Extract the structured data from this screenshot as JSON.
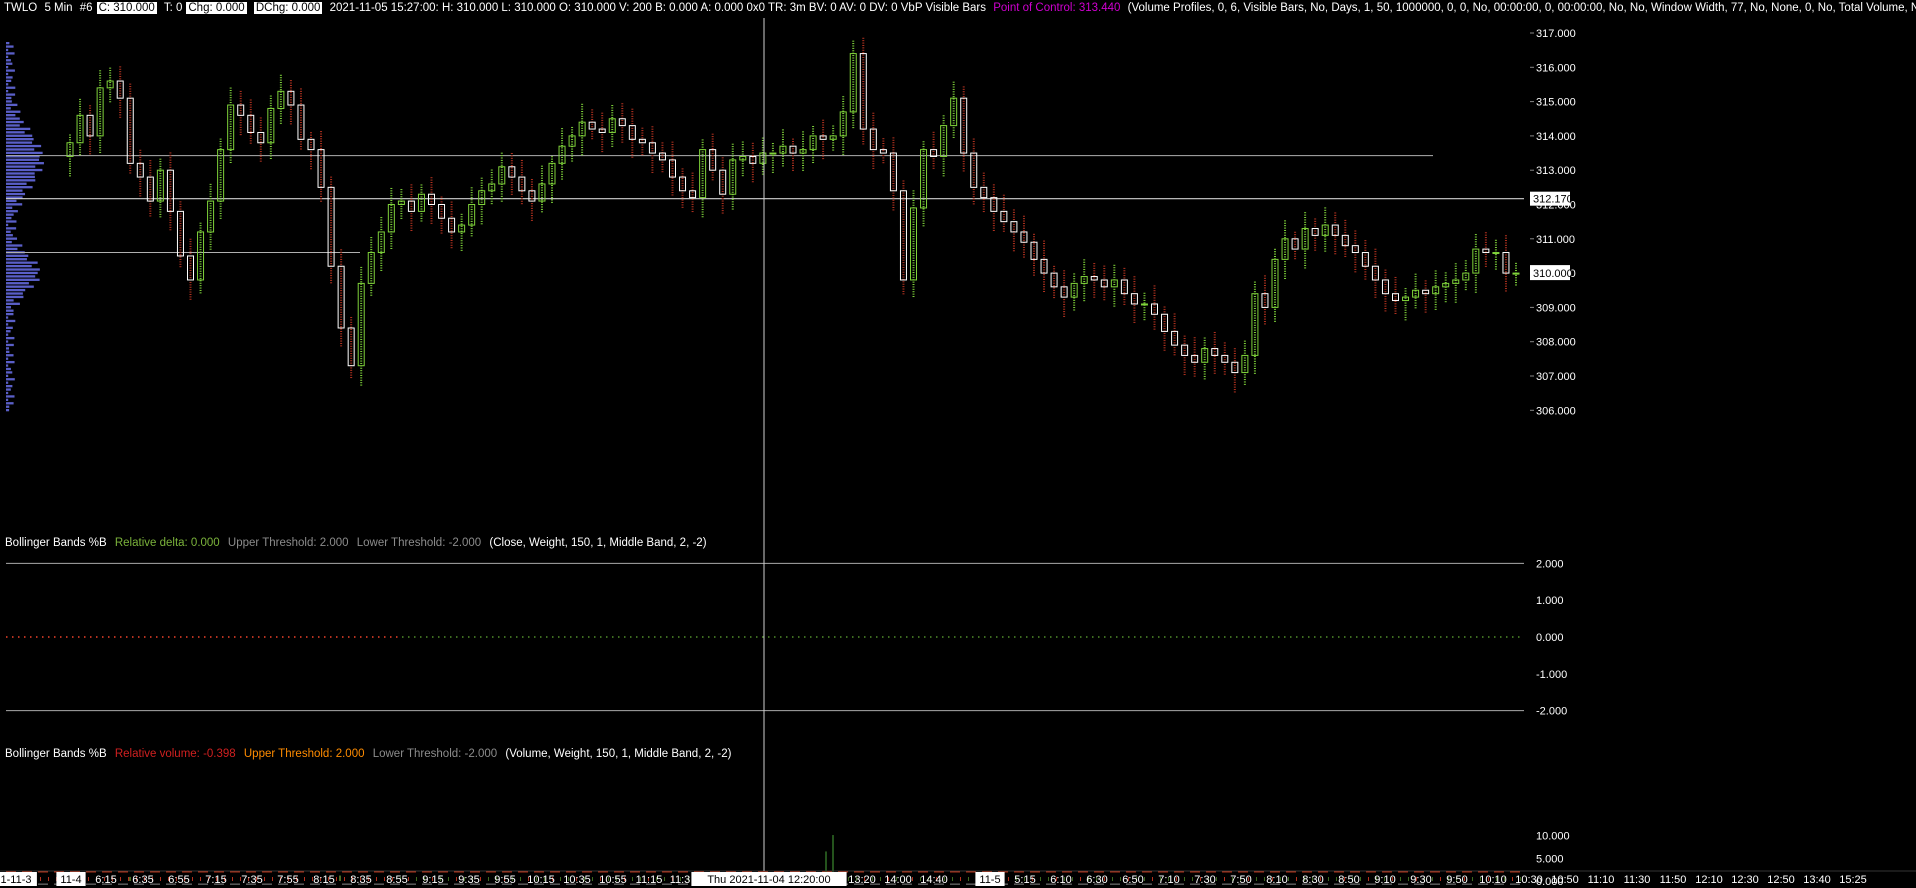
{
  "header": {
    "symbol": "TWLO",
    "interval": "5 Min",
    "chart_no": "#6",
    "close_box": "C: 310.000",
    "t_field": "T: 0",
    "chg_box": "Chg: 0.000",
    "dchg_box": "DChg: 0.000",
    "ohlc_text": "2021-11-05 15:27:00: H: 310.000 L: 310.000 O: 310.000 V: 200 B: 0.000 A: 0.000 0x0 TR: 3m BV: 0 AV: 0 DV: 0 VbP Visible Bars",
    "poc_text": "Point of Control: 313.440",
    "study_params": "(Volume Profiles, 0, 6, Visible Bars, No, Days, 1, 50, 1000000, 0, 0, No, 00:00:00, 0, 00:00:00, No, No, Window Width, 77, No, None, 0, No, Total Volume, No"
  },
  "panel2": {
    "title": "Bollinger Bands %B",
    "rel_label": "Relative delta: 0.000",
    "upper": "Upper Threshold: 2.000",
    "lower": "Lower Threshold: -2.000",
    "params": "(Close, Weight, 150, 1, Middle Band, 2, -2)"
  },
  "panel3": {
    "title": "Bollinger Bands %B",
    "rel_label": "Relative volume: -0.398",
    "upper": "Upper Threshold: 2.000",
    "lower": "Lower Threshold: -2.000",
    "params": "(Volume, Weight, 150, 1, Middle Band, 2, -2)"
  },
  "colors": {
    "bg": "#000000",
    "up": "#7fd33a",
    "down": "#b43220",
    "profile": "#5a5fc8",
    "line": "#b0b0b0",
    "text": "#ffffff"
  },
  "chart_data": [
    {
      "type": "candlestick",
      "title": "TWLO 5 Min",
      "ylim": [
        305.6,
        317.3
      ],
      "yticks": [
        "317.000",
        "316.000",
        "315.000",
        "314.000",
        "313.000",
        "312.000",
        "311.000",
        "310.000",
        "309.000",
        "308.000",
        "307.000",
        "306.000"
      ],
      "ytick_values": [
        317,
        316,
        315,
        314,
        313,
        312,
        311,
        310,
        309,
        308,
        307,
        306
      ],
      "current_price_tag": "312.170",
      "current_price": 312.17,
      "last_price_tag": "310.000",
      "last_price": 310.0,
      "point_of_control": 313.44,
      "value_area_low": 310.6,
      "xlabels": [
        "1-11-3",
        "11-4",
        "6:15",
        "6:35",
        "6:55",
        "7:15",
        "7:35",
        "7:55",
        "8:15",
        "8:35",
        "8:55",
        "9:15",
        "9:35",
        "9:55",
        "10:15",
        "10:35",
        "10:55",
        "11:15",
        "11:3",
        "Thu 2021-11-04  12:20:00",
        "5",
        "13:20",
        "14:00",
        "14:40",
        "11-5",
        "5:15",
        "6:10",
        "6:30",
        "6:50",
        "7:10",
        "7:30",
        "7:50",
        "8:10",
        "8:30",
        "8:50",
        "9:10",
        "9:30",
        "9:50",
        "10:10",
        "10:30",
        "10:50",
        "11:10",
        "11:30",
        "11:50",
        "12:10",
        "12:30",
        "12:50",
        "13:40",
        "15:25"
      ],
      "closes": [
        313.8,
        314.6,
        314.0,
        315.4,
        315.6,
        315.1,
        313.2,
        312.8,
        312.1,
        313.0,
        311.8,
        310.5,
        309.8,
        311.2,
        312.1,
        313.6,
        314.9,
        314.6,
        314.1,
        313.8,
        314.8,
        315.3,
        314.9,
        313.9,
        313.6,
        312.5,
        310.2,
        308.4,
        307.3,
        309.7,
        310.6,
        311.2,
        312.0,
        312.1,
        311.8,
        312.3,
        312.0,
        311.6,
        311.2,
        311.4,
        312.0,
        312.4,
        312.6,
        313.1,
        312.8,
        312.4,
        312.1,
        312.6,
        313.2,
        313.7,
        314.0,
        314.4,
        314.2,
        314.1,
        314.5,
        314.3,
        313.9,
        313.8,
        313.5,
        313.3,
        312.8,
        312.4,
        312.2,
        313.6,
        313.0,
        312.3,
        313.3,
        313.4,
        313.2,
        313.5,
        313.5,
        313.7,
        313.5,
        313.6,
        314.0,
        313.9,
        314.0,
        314.7,
        316.4,
        314.2,
        313.6,
        313.5,
        312.4,
        309.8,
        311.9,
        313.6,
        313.4,
        314.3,
        315.1,
        313.5,
        312.5,
        312.2,
        311.8,
        311.5,
        311.2,
        310.9,
        310.4,
        310.0,
        309.6,
        309.3,
        309.7,
        309.9,
        309.8,
        309.6,
        309.8,
        309.4,
        309.1,
        309.1,
        308.8,
        308.3,
        307.9,
        307.6,
        307.4,
        307.8,
        307.6,
        307.4,
        307.1,
        307.6,
        309.4,
        309.0,
        310.4,
        311.0,
        310.7,
        311.3,
        311.1,
        311.4,
        311.1,
        310.8,
        310.6,
        310.2,
        309.8,
        309.4,
        309.2,
        309.3,
        309.5,
        309.4,
        309.6,
        309.7,
        309.8,
        310.0,
        310.7,
        310.6,
        310.6,
        310.0,
        310.0
      ]
    },
    {
      "type": "line",
      "title": "Bollinger Bands %B (Close)",
      "ylim": [
        -2.2,
        2.2
      ],
      "yticks": [
        "2.000",
        "1.000",
        "0.000",
        "-1.000",
        "-2.000"
      ],
      "ytick_values": [
        2,
        1,
        0,
        -1,
        -2
      ],
      "upper_threshold": 2.0,
      "lower_threshold": -2.0,
      "relative_delta": 0.0
    },
    {
      "type": "bar",
      "title": "Bollinger Bands %B (Volume)",
      "ylim": [
        -0.8,
        11.5
      ],
      "yticks": [
        "10.000",
        "5.000",
        "0.000"
      ],
      "ytick_values": [
        10,
        5,
        0
      ],
      "upper_threshold": 2.0,
      "lower_threshold": -2.0,
      "relative_volume": -0.398,
      "spikes": [
        {
          "x_label": "12:20",
          "value": 10.1
        },
        {
          "x_label": "12:20",
          "value": 6.5
        },
        {
          "x_label": "8:15",
          "value": 1.2
        },
        {
          "x_label": "6:35",
          "value": 0.9
        }
      ]
    }
  ]
}
